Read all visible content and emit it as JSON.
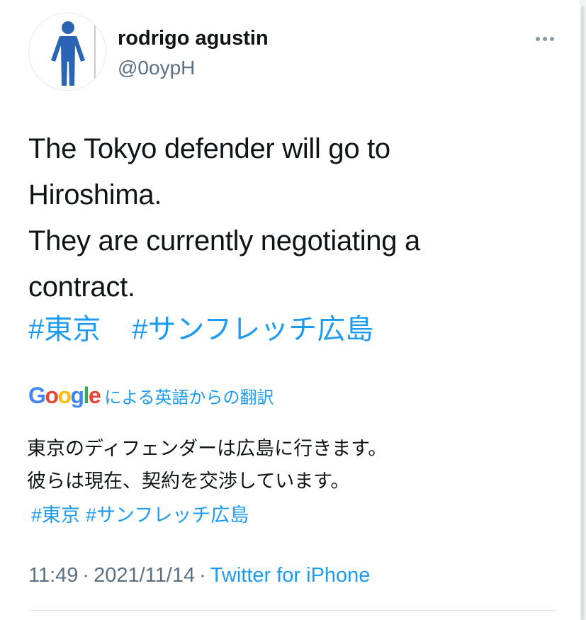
{
  "tweet": {
    "author": {
      "display_name": "rodrigo agustin",
      "handle": "@0oypH",
      "avatar_icon": "person-figure-icon"
    },
    "more_icon": "more-horizontal-icon",
    "text_lines": [
      "The Tokyo defender will go to",
      "Hiroshima.",
      "They are currently negotiating a",
      "contract."
    ],
    "hashtags": [
      "#東京",
      "#サンフレッチ広島"
    ],
    "translation": {
      "provider": "Google",
      "label": "による英語からの翻訳",
      "lines": [
        "東京のディフェンダーは広島に行きます。",
        "彼らは現在、契約を交渉しています。"
      ],
      "hashtags": [
        "#東京",
        "#サンフレッチ広島"
      ]
    },
    "meta": {
      "time": "11:49",
      "separator": "·",
      "date": "2021/11/14",
      "source": "Twitter for iPhone"
    }
  },
  "colors": {
    "link": "#1d9bf0",
    "secondary_text": "#5b7083",
    "google_blue": "#4285f4",
    "google_red": "#ea4335",
    "google_yellow": "#fbbc05",
    "google_green": "#34a853",
    "avatar_figure": "#2b63b5"
  }
}
